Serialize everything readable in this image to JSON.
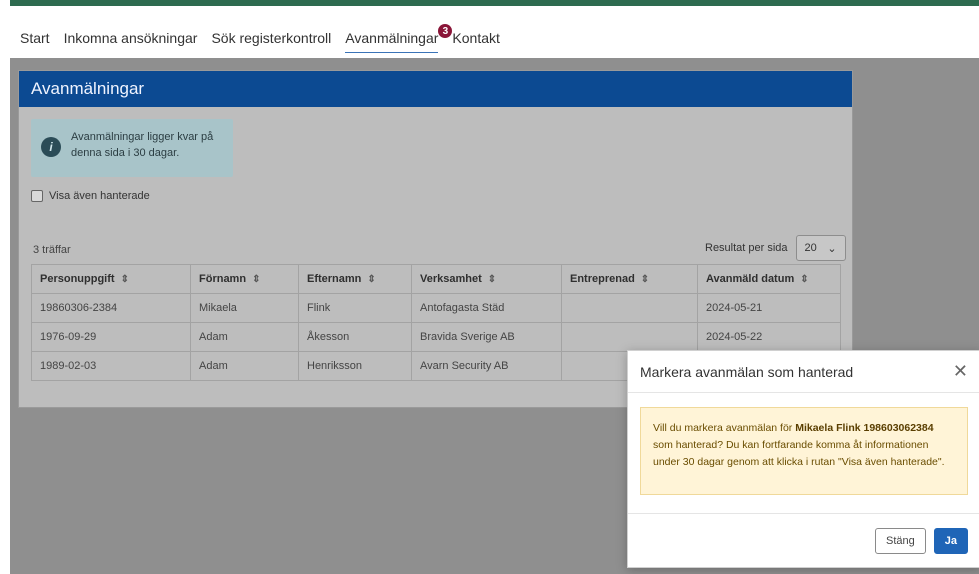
{
  "nav": {
    "items": [
      "Start",
      "Inkomna ansökningar",
      "Sök registerkontroll",
      "Avanmälningar",
      "Kontakt"
    ],
    "active_index": 3,
    "badge": "3"
  },
  "page": {
    "title": "Avanmälningar",
    "info_text_line1": "Avanmälningar ligger kvar på",
    "info_text_line2": "denna sida i 30 dagar.",
    "checkbox_label": "Visa även hanterade",
    "result_count": "3 träffar",
    "per_page_label": "Resultat per sida",
    "per_page_value": "20",
    "table": {
      "columns": [
        "Personuppgift",
        "Förnamn",
        "Efternamn",
        "Verksamhet",
        "Entreprenad",
        "Avanmäld datum"
      ],
      "rows": [
        [
          "19860306-2384",
          "Mikaela",
          "Flink",
          "Antofagasta Städ",
          "",
          "2024-05-21"
        ],
        [
          "1976-09-29",
          "Adam",
          "Åkesson",
          "Bravida Sverige AB",
          "",
          "2024-05-22"
        ],
        [
          "1989-02-03",
          "Adam",
          "Henriksson",
          "Avarn Security AB",
          "",
          ""
        ]
      ]
    }
  },
  "modal": {
    "title": "Markera avanmälan som hanterad",
    "close_icon": "close-icon",
    "message_pre": "Vill du markera avanmälan för",
    "message_bold": "Mikaela Flink 198603062384",
    "message_post": "som hanterad? Du kan fortfarande komma åt informationen under 30 dagar genom att klicka i rutan \"Visa även hanterade\".",
    "cancel_label": "Stäng",
    "confirm_label": "Ja"
  }
}
